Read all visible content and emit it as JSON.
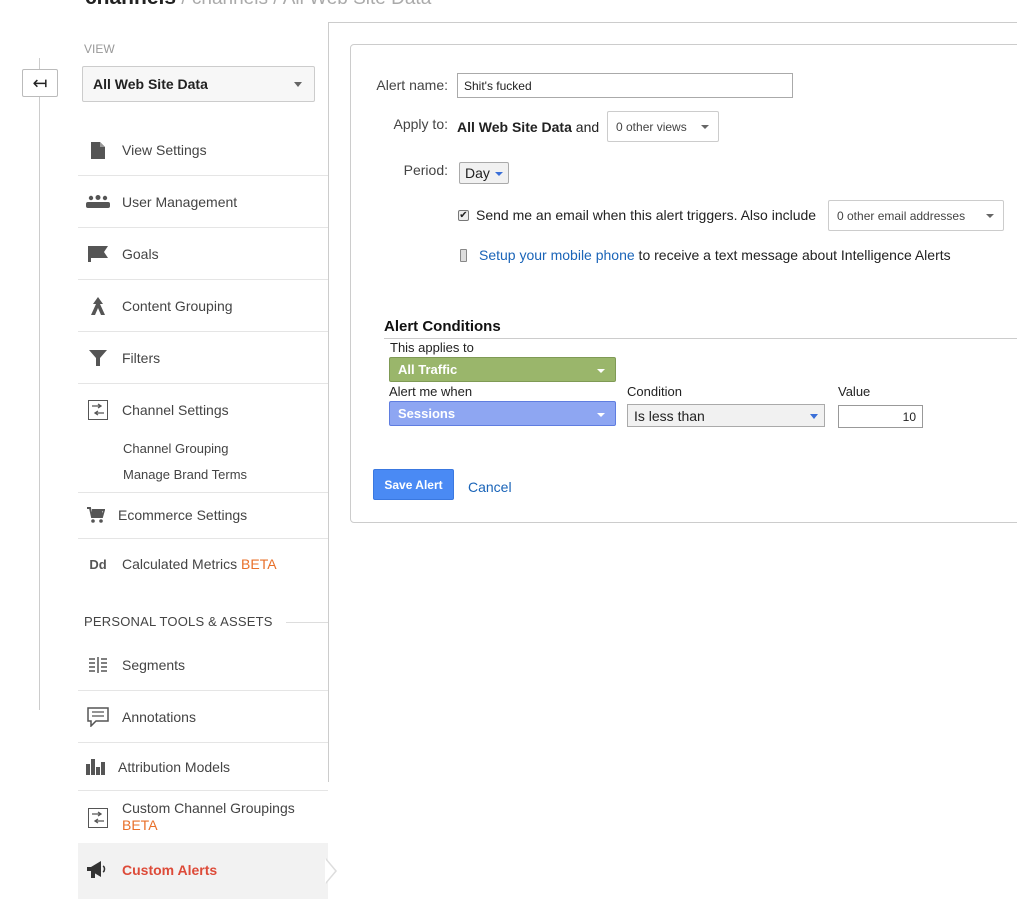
{
  "header": {
    "title": "channels",
    "breadcrumb": " / channels / All Web Site Data"
  },
  "sidebar": {
    "view_label": "VIEW",
    "view_selected": "All Web Site Data",
    "items": [
      {
        "label": "View Settings",
        "icon": "document-icon"
      },
      {
        "label": "User Management",
        "icon": "users-icon"
      },
      {
        "label": "Goals",
        "icon": "flag-icon"
      },
      {
        "label": "Content Grouping",
        "icon": "grouping-icon"
      },
      {
        "label": "Filters",
        "icon": "filter-icon"
      },
      {
        "label": "Channel Settings",
        "icon": "channel-icon"
      },
      {
        "label": "Ecommerce Settings",
        "icon": "cart-icon"
      },
      {
        "label": "Calculated Metrics",
        "icon": "dd-icon"
      }
    ],
    "sub_items": [
      "Channel Grouping",
      "Manage Brand Terms"
    ],
    "beta_label": "BETA",
    "personal_section": "PERSONAL TOOLS & ASSETS",
    "personal_items": [
      {
        "label": "Segments",
        "icon": "segments-icon"
      },
      {
        "label": "Annotations",
        "icon": "annotation-icon"
      },
      {
        "label": "Attribution Models",
        "icon": "bars-icon"
      },
      {
        "label": "Custom Channel Groupings",
        "icon": "channel-icon"
      },
      {
        "label": "Custom Alerts",
        "icon": "megaphone-icon"
      }
    ]
  },
  "form": {
    "alert_name_label": "Alert name:",
    "alert_name_value": "Shit's fucked",
    "apply_to_label": "Apply to:",
    "apply_to_view": "All Web Site Data",
    "apply_and": "and",
    "other_views": "0 other views",
    "period_label": "Period:",
    "period_value": "Day",
    "email_text": "Send me an email when this alert triggers. Also include",
    "other_emails": "0 other email addresses",
    "mobile_link": "Setup your mobile phone",
    "mobile_text": " to receive a text message about Intelligence Alerts"
  },
  "conditions": {
    "title": "Alert Conditions",
    "applies_to_label": "This applies to",
    "applies_to_value": "All Traffic",
    "alert_when_label": "Alert me when",
    "alert_when_value": "Sessions",
    "condition_label": "Condition",
    "condition_value": "Is less than",
    "value_label": "Value",
    "value": "10"
  },
  "actions": {
    "save_label": "Save Alert",
    "cancel_label": "Cancel"
  },
  "colors": {
    "accent": "#4a8af4",
    "link": "#1a64b8",
    "beta": "#e8702a",
    "active": "#dd4b39",
    "green_pill": "#9ab66b",
    "blue_pill": "#8ea6f2"
  }
}
